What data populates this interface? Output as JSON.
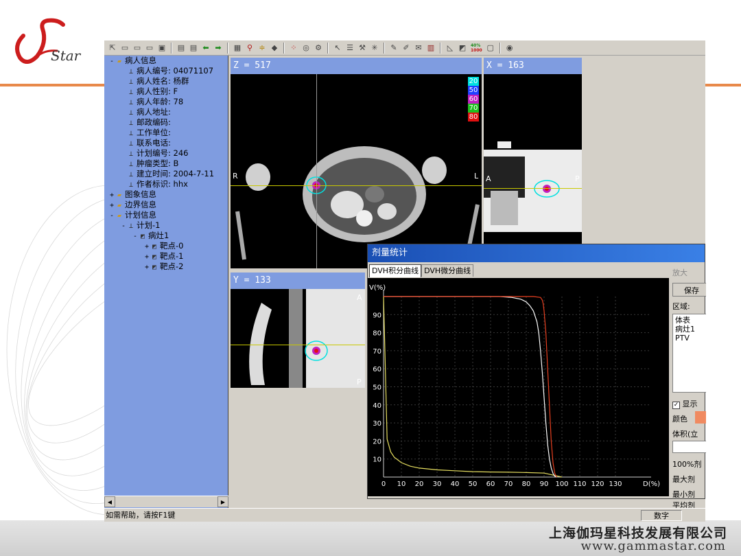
{
  "slide": {
    "company_name": "上海伽玛星科技发展有限公司",
    "company_url": "www.gammastar.com",
    "colors": {
      "accent_line": "#e8894a",
      "logo_red": "#cc1d1d"
    }
  },
  "toolbar": {
    "icons": [
      "exit-icon",
      "open-folder-icon",
      "folder-icon",
      "folder-icon",
      "save-icon",
      "layout-icon",
      "layout-icon",
      "arrow-left-icon",
      "arrow-right-icon",
      "image-icon",
      "zoom-icon",
      "window-level-icon",
      "book-icon",
      "grid-icon",
      "contour-icon",
      "gear-icon",
      "pointer-icon",
      "list-icon",
      "tool-icon",
      "sun-icon",
      "pen-icon",
      "edit-icon",
      "mail-icon",
      "bars-icon",
      "ruler-icon",
      "dose-icon",
      "monitor-icon",
      "globe-icon"
    ],
    "dose_values": [
      "40%",
      "1000"
    ]
  },
  "tree": {
    "rows": [
      {
        "toggle": "-",
        "label": "病人信息"
      },
      {
        "label": "病人编号: 04071107"
      },
      {
        "label": "病人姓名: 杨群"
      },
      {
        "label": "病人性别: F"
      },
      {
        "label": "病人年龄: 78"
      },
      {
        "label": "病人地址:"
      },
      {
        "label": "邮政编码:"
      },
      {
        "label": "工作单位:"
      },
      {
        "label": "联系电话:"
      },
      {
        "label": "计划编号: 246"
      },
      {
        "label": "肿瘤类型: B"
      },
      {
        "label": "建立时间: 2004-7-11"
      },
      {
        "label": "作者标识: hhx"
      },
      {
        "toggle": "+",
        "label": "图象信息"
      },
      {
        "toggle": "+",
        "label": "边界信息"
      },
      {
        "toggle": "-",
        "label": "计划信息"
      },
      {
        "toggle": "-",
        "label": "计划-1"
      },
      {
        "toggle": "-",
        "label": "病灶1"
      },
      {
        "toggle": "+",
        "label": "靶点-0"
      },
      {
        "toggle": "+",
        "label": "靶点-1"
      },
      {
        "toggle": "+",
        "label": "靶点-2"
      }
    ]
  },
  "views": {
    "z": {
      "title": "Z = 517",
      "left_marker": "R",
      "right_marker": "L"
    },
    "x": {
      "title": "X = 163",
      "left_marker": "A",
      "right_marker": "P"
    },
    "y": {
      "title": "Y = 133",
      "top_marker": "A",
      "bottom_marker": "P"
    },
    "isodose_legend": [
      {
        "value": "20",
        "color": "#00e0e0"
      },
      {
        "value": "50",
        "color": "#2040ff"
      },
      {
        "value": "60",
        "color": "#c020c0"
      },
      {
        "value": "70",
        "color": "#20c020"
      },
      {
        "value": "80",
        "color": "#e01010"
      }
    ]
  },
  "dialog": {
    "title": "剂量统计",
    "tabs": [
      "DVH积分曲线",
      "DVH微分曲线"
    ],
    "side": {
      "zoom_label": "放大",
      "save_label": "保存",
      "region_label": "区域:",
      "regions": [
        "体表",
        "病灶1",
        "PTV"
      ],
      "show_label": "显示",
      "color_label": "颜色",
      "volume_label": "体积(立",
      "dose100_label": "100%剂",
      "max_dose_label": "最大剂",
      "min_dose_label": "最小剂",
      "avg_dose_label": "平均剂"
    }
  },
  "chart_data": {
    "type": "line",
    "ylabel": "V(%)",
    "xlabel": "D(%)",
    "xlim": [
      0,
      150
    ],
    "ylim": [
      0,
      100
    ],
    "x_ticks": [
      0,
      10,
      20,
      30,
      40,
      50,
      60,
      70,
      80,
      90,
      100,
      110,
      120,
      130
    ],
    "y_ticks": [
      10,
      20,
      30,
      40,
      50,
      60,
      70,
      80,
      90
    ],
    "grid": true,
    "series": [
      {
        "color": "#e8e060",
        "x": [
          0,
          2,
          4,
          6,
          10,
          15,
          20,
          30,
          40,
          50,
          60,
          70,
          80,
          90,
          100
        ],
        "y": [
          100,
          21,
          14,
          11,
          8,
          6,
          5,
          4,
          3.5,
          3,
          2.8,
          2.7,
          2.5,
          2.2,
          0
        ]
      },
      {
        "color": "#ffffff",
        "x": [
          0,
          50,
          65,
          72,
          77,
          80,
          82,
          84,
          86,
          87,
          88,
          89,
          90,
          91,
          92,
          93,
          94,
          95,
          96,
          97
        ],
        "y": [
          100,
          100,
          100,
          99.5,
          98.5,
          97,
          95,
          92,
          86,
          80,
          70,
          58,
          44,
          30,
          18,
          10,
          5,
          2,
          0.5,
          0
        ]
      },
      {
        "color": "#e84020",
        "x": [
          0,
          60,
          70,
          78,
          84,
          88,
          89,
          89.5,
          90,
          91,
          92,
          93,
          94,
          95,
          96,
          97
        ],
        "y": [
          100,
          100,
          100,
          100,
          100,
          99.5,
          98,
          96,
          92,
          80,
          60,
          40,
          20,
          8,
          2,
          0
        ]
      }
    ]
  },
  "statusbar": {
    "help_text": "如需帮助，请按F1键",
    "mode_text": "数字"
  }
}
